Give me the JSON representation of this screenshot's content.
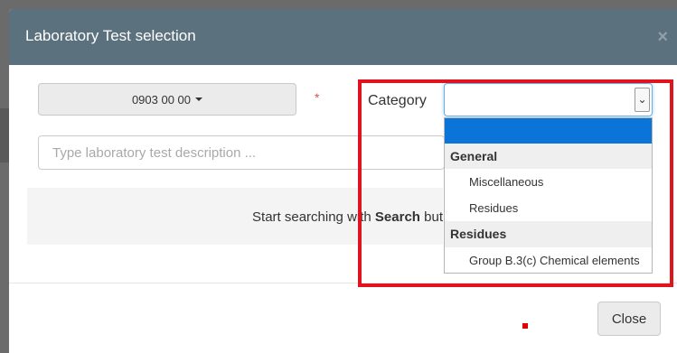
{
  "modal": {
    "title": "Laboratory Test selection",
    "close_icon": "×"
  },
  "form": {
    "code_button_label": "0903 00 00",
    "required_marker": "*",
    "category_label": "Category",
    "category_value": "",
    "search_placeholder": "Type laboratory test description ..."
  },
  "dropdown": {
    "blank_option": "",
    "groups": [
      {
        "label": "General",
        "items": [
          "Miscellaneous",
          "Residues"
        ]
      },
      {
        "label": "Residues",
        "items": [
          "Group B.3(c) Chemical elements"
        ]
      }
    ]
  },
  "info": {
    "prefix": "Start searching with ",
    "bold": "Search",
    "suffix": " but"
  },
  "footer": {
    "close_label": "Close"
  },
  "colors": {
    "header": "#5b717d",
    "highlight": "#e0141e",
    "selected_option": "#0a74d9"
  }
}
